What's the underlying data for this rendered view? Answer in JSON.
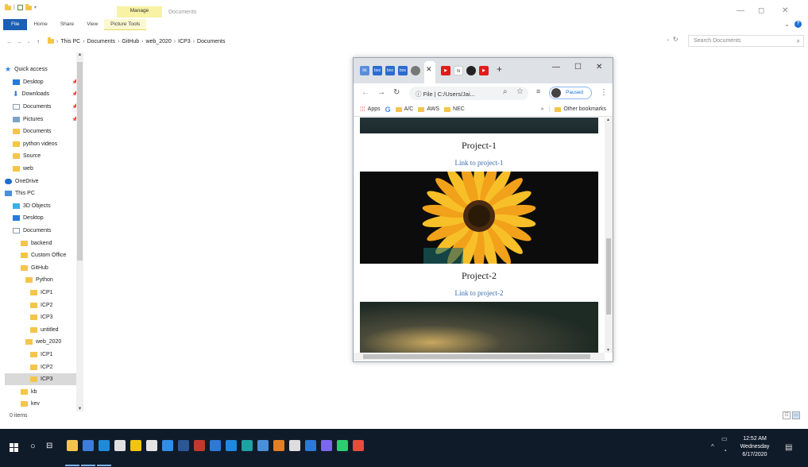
{
  "explorer": {
    "manage_tab": "Manage",
    "window_title": "Documents",
    "ribbon_tabs": [
      "File",
      "Home",
      "Share",
      "View",
      "Picture Tools"
    ],
    "breadcrumbs": [
      "This PC",
      "Documents",
      "GitHub",
      "web_2020",
      "ICP3",
      "Documents"
    ],
    "search_placeholder": "Search Documents",
    "nav_items": [
      {
        "label": "Quick access",
        "icon": "star",
        "pin": false
      },
      {
        "label": "Desktop",
        "icon": "blue",
        "pin": true
      },
      {
        "label": "Downloads",
        "icon": "down",
        "pin": true
      },
      {
        "label": "Documents",
        "icon": "doc",
        "pin": true
      },
      {
        "label": "Pictures",
        "icon": "pic",
        "pin": true
      },
      {
        "label": "Documents",
        "icon": "yel",
        "pin": false
      },
      {
        "label": "python videos",
        "icon": "yel",
        "pin": false
      },
      {
        "label": "Source",
        "icon": "yel",
        "pin": false
      },
      {
        "label": "web",
        "icon": "yel",
        "pin": false
      },
      {
        "label": "OneDrive",
        "icon": "cloud",
        "pin": false
      },
      {
        "label": "This PC",
        "icon": "pc",
        "pin": false
      },
      {
        "label": "3D Objects",
        "icon": "cube",
        "pin": false
      },
      {
        "label": "Desktop",
        "icon": "blue",
        "pin": false
      },
      {
        "label": "Documents",
        "icon": "doc",
        "pin": false
      },
      {
        "label": "backend",
        "icon": "yel",
        "pin": false
      },
      {
        "label": "Custom Office",
        "icon": "yel",
        "pin": false
      },
      {
        "label": "GitHub",
        "icon": "yel",
        "pin": false
      },
      {
        "label": "Python",
        "icon": "yel",
        "pin": false
      },
      {
        "label": "ICP1",
        "icon": "yel",
        "pin": false
      },
      {
        "label": "ICP2",
        "icon": "yel",
        "pin": false
      },
      {
        "label": "ICP3",
        "icon": "yel",
        "pin": false
      },
      {
        "label": "untitled",
        "icon": "yel",
        "pin": false
      },
      {
        "label": "web_2020",
        "icon": "yel",
        "pin": false
      },
      {
        "label": "ICP1",
        "icon": "yel",
        "pin": false
      },
      {
        "label": "ICP2",
        "icon": "yel",
        "pin": false
      },
      {
        "label": "ICP3",
        "icon": "yel",
        "pin": false,
        "selected": true
      },
      {
        "label": "kb",
        "icon": "yel",
        "pin": false
      },
      {
        "label": "kev",
        "icon": "yel",
        "pin": false
      }
    ],
    "status": "0 items"
  },
  "chrome": {
    "omnibox": "File | C:/Users/Jai...",
    "profile": "Paused",
    "bookmarks": [
      "Apps",
      "A/C",
      "AWS",
      "NEC",
      "Other bookmarks"
    ],
    "projects": [
      {
        "title": "Project-1",
        "link": "Link to project-1"
      },
      {
        "title": "Project-2",
        "link": "Link to project-2"
      }
    ]
  },
  "taskbar": {
    "time": "12:52 AM",
    "day": "Wednesday",
    "date": "6/17/2020"
  }
}
